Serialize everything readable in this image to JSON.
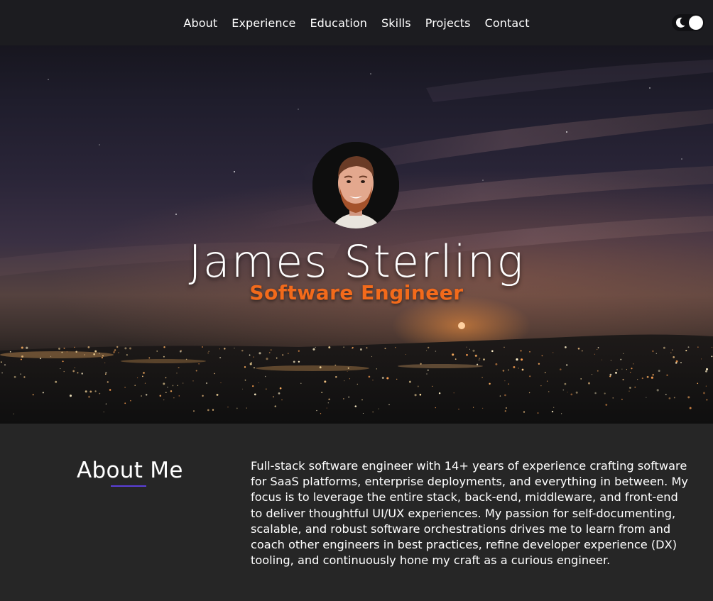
{
  "nav": {
    "links": [
      "About",
      "Experience",
      "Education",
      "Skills",
      "Projects",
      "Contact"
    ],
    "theme_toggle": {
      "moon_icon": "moon-icon",
      "state": "dark"
    }
  },
  "hero": {
    "name": "James Sterling",
    "title": "Software Engineer",
    "avatar_icon": "profile-photo",
    "accent_color": "#f26a1b"
  },
  "about": {
    "heading": "About Me",
    "body": "Full-stack software engineer with 14+ years of experience crafting software for SaaS platforms, enterprise deployments, and everything in between. My focus is to leverage the entire stack, back-end, middleware, and front-end to deliver thoughtful UI/UX experiences. My passion for self-documenting, scalable, and robust software orchestrations drives me to learn from and coach other engineers in best practices, refine developer experience (DX) tooling, and continuously hone my craft as a curious engineer.",
    "underline_color": "#5b3fd9"
  }
}
